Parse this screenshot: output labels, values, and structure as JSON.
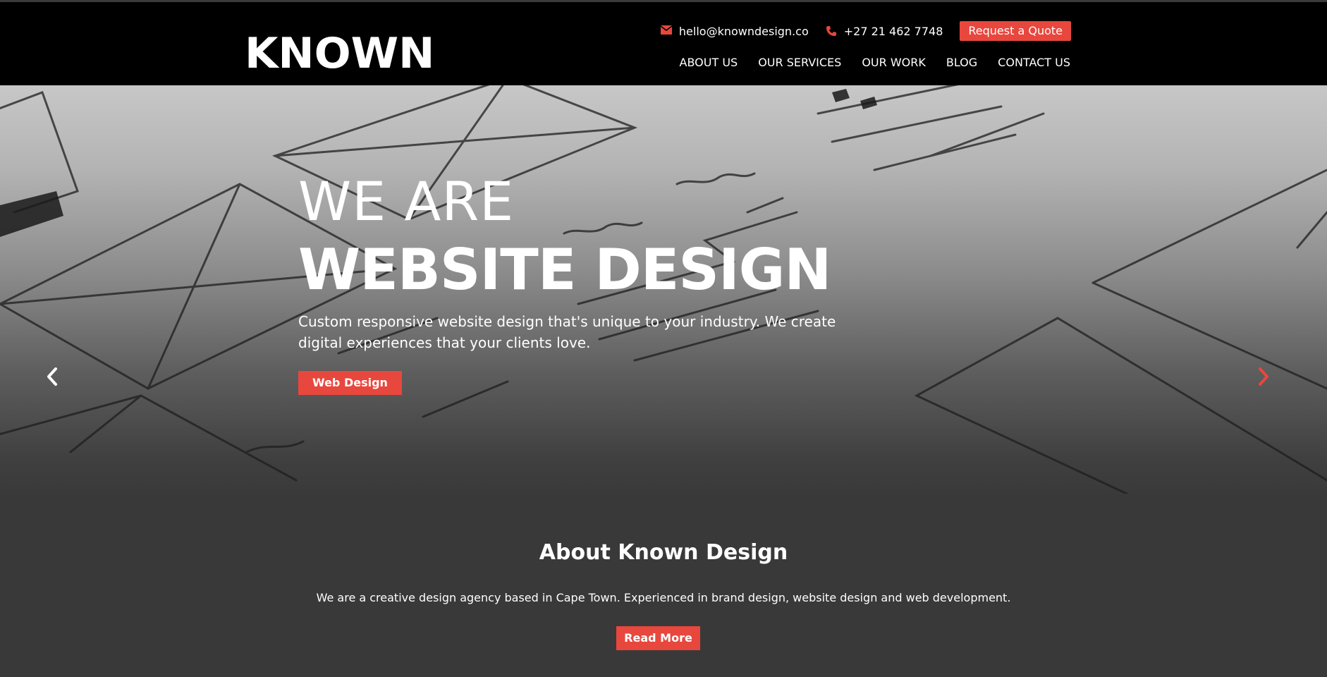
{
  "header": {
    "logo": "KNOWN",
    "email": "hello@knowndesign.co",
    "phone": "+27 21 462 7748",
    "quote_button": "Request a Quote",
    "nav": [
      "ABOUT US",
      "OUR SERVICES",
      "OUR WORK",
      "BLOG",
      "CONTACT US"
    ]
  },
  "hero": {
    "line1": "WE ARE",
    "line2": "WEBSITE DESIGN",
    "description": "Custom responsive website design that's unique to your industry. We create digital experiences that your clients love.",
    "button": "Web Design"
  },
  "about": {
    "title": "About Known Design",
    "text": "We are a creative design agency based in Cape Town. Experienced in brand design, website design and web development.",
    "button": "Read More"
  },
  "colors": {
    "accent": "#e8473e",
    "header_bg": "#000000",
    "section_bg": "#393939"
  },
  "icons": {
    "email": "envelope-icon",
    "phone": "phone-icon",
    "prev": "chevron-left-icon",
    "next": "chevron-right-icon"
  }
}
